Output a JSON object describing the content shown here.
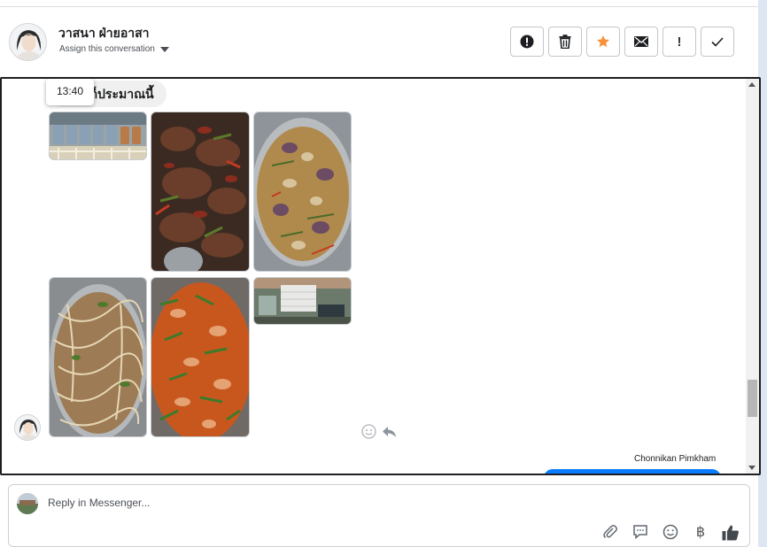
{
  "header": {
    "contact_name": "วาสนา ฝ่ายอาสา",
    "assign_label": "Assign this conversation",
    "actions": [
      {
        "icon": "alert-circle-icon",
        "label": "Mark as spam"
      },
      {
        "icon": "trash-icon",
        "label": "Delete"
      },
      {
        "icon": "star-icon",
        "label": "Star"
      },
      {
        "icon": "envelope-icon",
        "label": "Mark as unread"
      },
      {
        "icon": "exclamation-icon",
        "text": "!"
      },
      {
        "icon": "checkmark-icon",
        "label": "Mark as done"
      }
    ]
  },
  "conversation": {
    "tooltip_time": "13:40",
    "message_text": "นก็ประมาณนี้",
    "photos": [
      {
        "name": "photo-rice-containers",
        "desc": "trays"
      },
      {
        "name": "photo-fried-dish"
      },
      {
        "name": "photo-curry-pot"
      },
      {
        "name": "photo-noodle-soup"
      },
      {
        "name": "photo-stir-fry-beans"
      },
      {
        "name": "photo-food-packs"
      }
    ],
    "sender_name": "Chonnikan Pimkham"
  },
  "reply": {
    "placeholder": "Reply in Messenger...",
    "tools": [
      "paperclip-icon",
      "speech-bubble-icon",
      "smiley-icon",
      "baht-icon",
      "thumbs-up-icon"
    ],
    "baht_symbol": "฿"
  },
  "colors": {
    "accent_star": "#f7923a",
    "blue_bubble": "#0a7cff",
    "message_bg": "#f0f0f0"
  }
}
